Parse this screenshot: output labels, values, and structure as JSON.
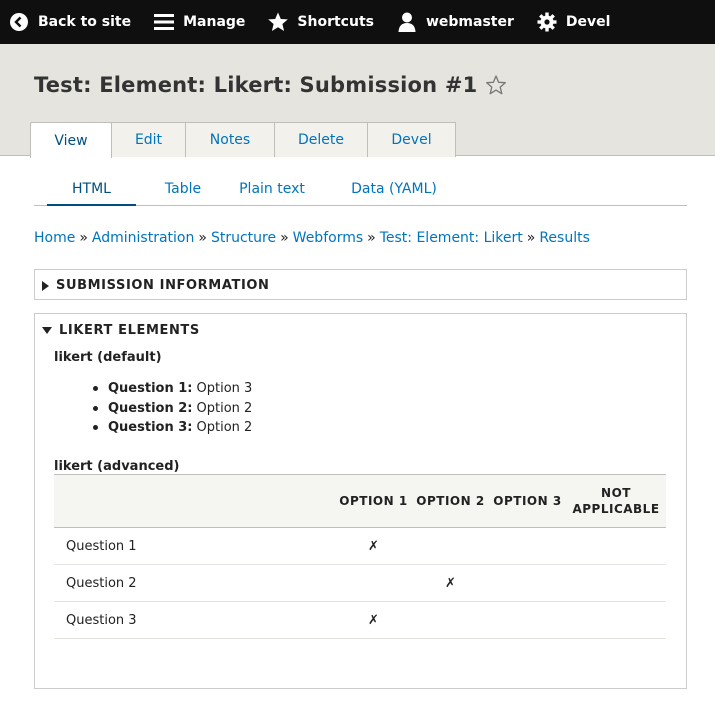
{
  "toolbar": {
    "items": [
      {
        "label": "Back to site",
        "icon": "back-arrow-icon"
      },
      {
        "label": "Manage",
        "icon": "menu-icon"
      },
      {
        "label": "Shortcuts",
        "icon": "star-icon"
      },
      {
        "label": "webmaster",
        "icon": "user-icon"
      },
      {
        "label": "Devel",
        "icon": "gear-icon"
      }
    ]
  },
  "page": {
    "title": "Test: Element: Likert: Submission #1"
  },
  "tabs": [
    {
      "label": "View",
      "active": true
    },
    {
      "label": "Edit"
    },
    {
      "label": "Notes"
    },
    {
      "label": "Delete"
    },
    {
      "label": "Devel"
    }
  ],
  "subtabs": [
    {
      "label": "HTML",
      "active": true
    },
    {
      "label": "Table"
    },
    {
      "label": "Plain text"
    },
    {
      "label": "Data (YAML)"
    }
  ],
  "breadcrumb": [
    "Home",
    "Administration",
    "Structure",
    "Webforms",
    "Test: Element: Likert",
    "Results"
  ],
  "breadcrumb_separator": "»",
  "submission_info": {
    "summary": "SUBMISSION INFORMATION",
    "expanded": false
  },
  "likert_elements": {
    "summary": "LIKERT ELEMENTS",
    "expanded": true,
    "default_label": "likert (default)",
    "default_items": [
      {
        "question": "Question 1:",
        "answer": "Option 3"
      },
      {
        "question": "Question 2:",
        "answer": "Option 2"
      },
      {
        "question": "Question 3:",
        "answer": "Option 2"
      }
    ],
    "advanced_label": "likert (advanced)",
    "table": {
      "headers": [
        "",
        "OPTION 1",
        "OPTION 2",
        "OPTION 3",
        "NOT APPLICABLE"
      ],
      "rows": [
        {
          "question": "Question 1",
          "cells": [
            "✗",
            "",
            "",
            ""
          ]
        },
        {
          "question": "Question 2",
          "cells": [
            "",
            "✗",
            "",
            ""
          ]
        },
        {
          "question": "Question 3",
          "cells": [
            "✗",
            "",
            "",
            ""
          ]
        }
      ]
    }
  },
  "colors": {
    "toolbar_bg": "#0f0f0f",
    "header_bg": "#e5e4df",
    "link": "#0074bd",
    "active_link": "#004f80"
  }
}
